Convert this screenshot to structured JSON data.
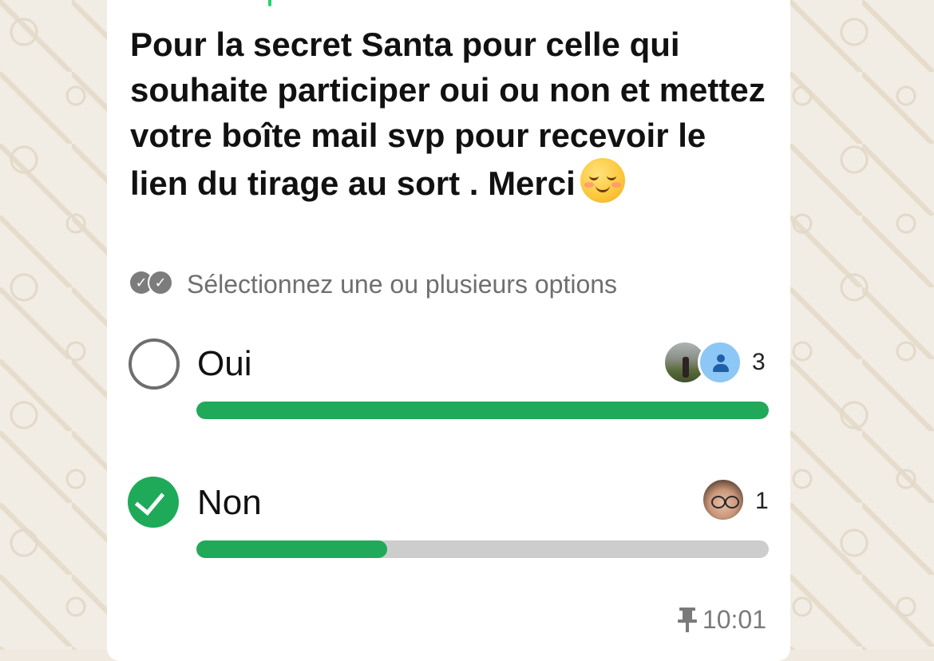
{
  "poll": {
    "question": "Pour la secret Santa pour celle qui souhaite participer oui ou non et mettez votre boîte mail svp pour recevoir le lien du tirage au sort . Merci",
    "emoji": "smiling-face-emoji",
    "instruction": "Sélectionnez une ou plusieurs options",
    "options": [
      {
        "label": "Oui",
        "votes": "3",
        "selected": false,
        "fraction": 1.0,
        "voter_avatars": [
          "photo-avatar",
          "default-avatar"
        ]
      },
      {
        "label": "Non",
        "votes": "1",
        "selected": true,
        "fraction": 0.333,
        "voter_avatars": [
          "photo-avatar"
        ]
      }
    ],
    "time": "10:01",
    "pinned": true
  },
  "colors": {
    "accent": "#21a95a",
    "track": "#cdcdcd",
    "text": "#111111",
    "muted": "#6f6f6f",
    "wallpaper": "#f1ece4"
  },
  "icons": {
    "multi_select": "double-check-icon",
    "pin": "pin-icon",
    "checked": "check-icon"
  }
}
